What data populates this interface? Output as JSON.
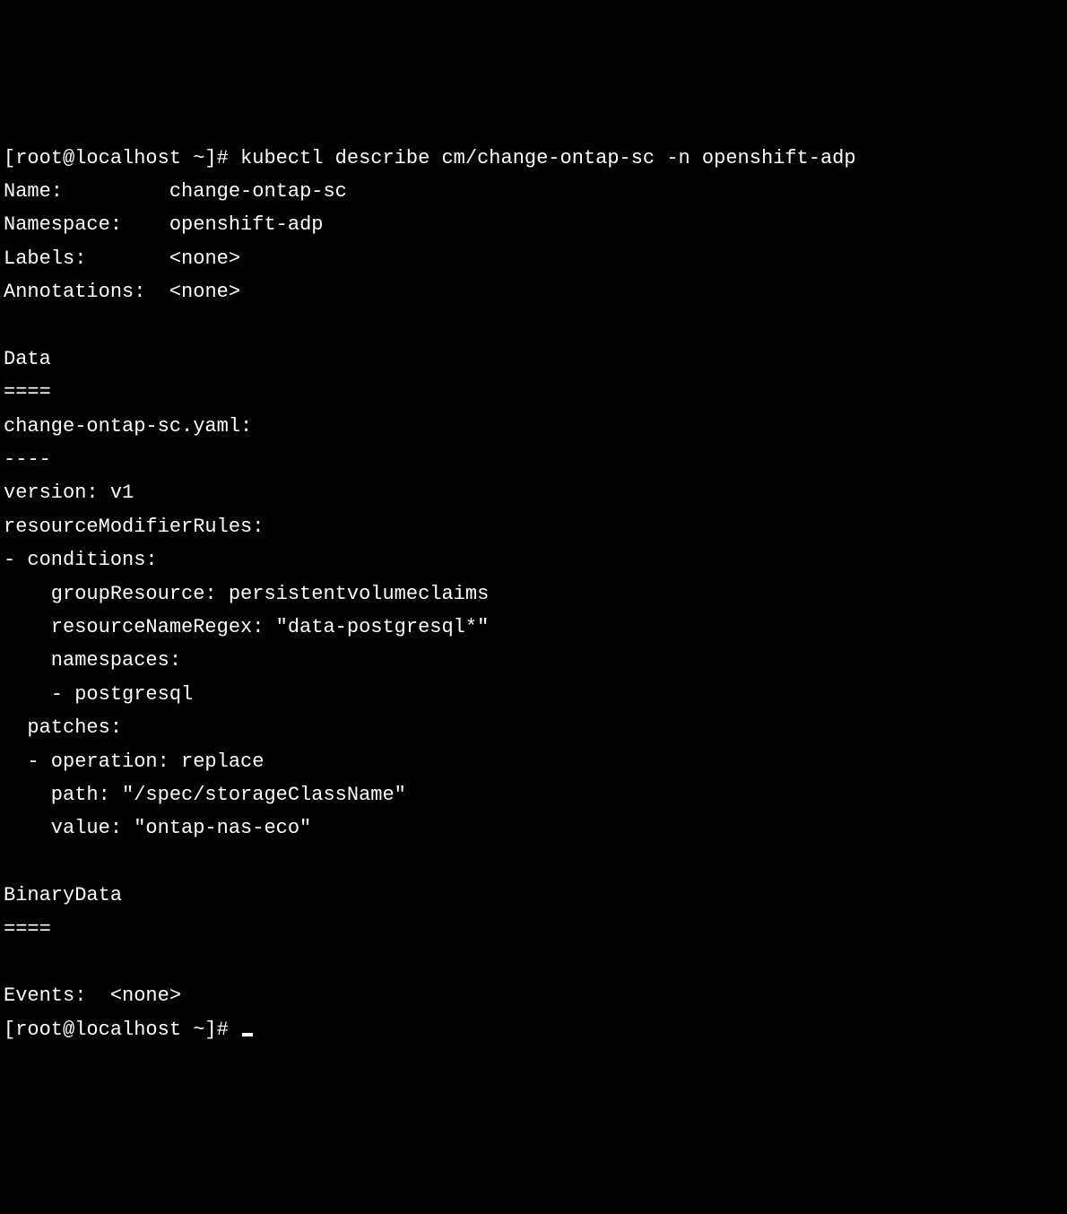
{
  "prompt1": "[root@localhost ~]# ",
  "command": "kubectl describe cm/change-ontap-sc -n openshift-adp",
  "fields": {
    "name_label": "Name:         ",
    "name_value": "change-ontap-sc",
    "namespace_label": "Namespace:    ",
    "namespace_value": "openshift-adp",
    "labels_label": "Labels:       ",
    "labels_value": "<none>",
    "annotations_label": "Annotations:  ",
    "annotations_value": "<none>"
  },
  "data_header": "Data",
  "data_sep": "====",
  "yaml_filename": "change-ontap-sc.yaml:",
  "yaml_dash": "----",
  "yaml_lines": {
    "l1": "version: v1",
    "l2": "resourceModifierRules:",
    "l3": "- conditions:",
    "l4": "    groupResource: persistentvolumeclaims",
    "l5": "    resourceNameRegex: \"data-postgresql*\"",
    "l6": "    namespaces:",
    "l7": "    - postgresql",
    "l8": "  patches:",
    "l9": "  - operation: replace",
    "l10": "    path: \"/spec/storageClassName\"",
    "l11": "    value: \"ontap-nas-eco\""
  },
  "binarydata_header": "BinaryData",
  "binarydata_sep": "====",
  "events_label": "Events:  ",
  "events_value": "<none>",
  "prompt2": "[root@localhost ~]# "
}
